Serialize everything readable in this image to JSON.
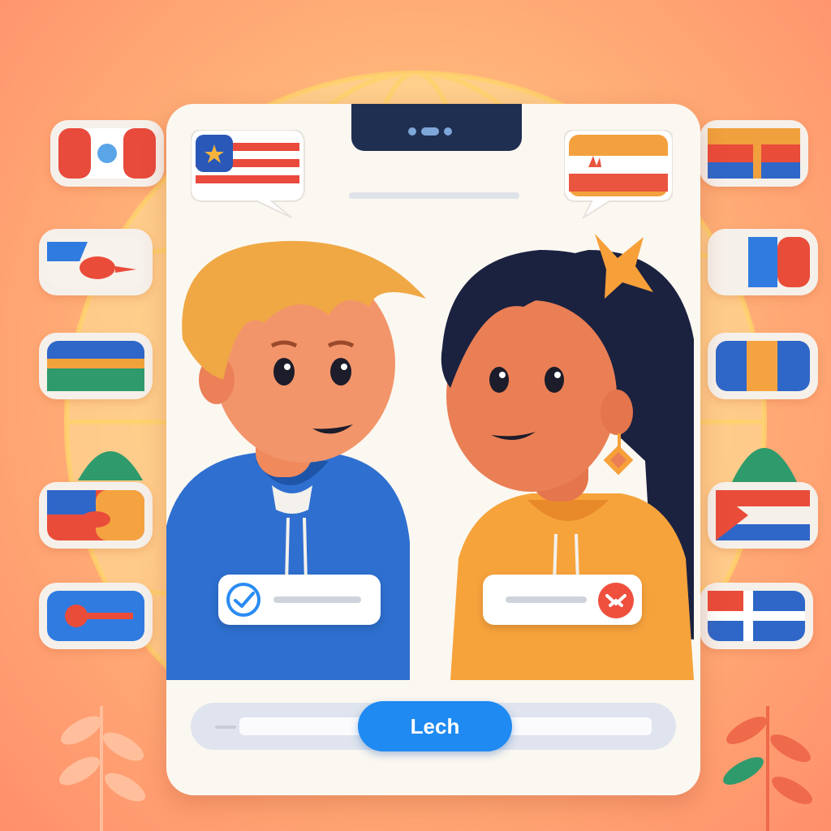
{
  "app": {
    "action_button_label": "Lech"
  },
  "colors": {
    "accent_blue": "#1f8af1",
    "boy_hoodie": "#2e6fcf",
    "girl_hoodie": "#f7a33c",
    "background_warm": "#ff9f70",
    "confirm_check": "#2a8bf2",
    "decline_red": "#ef4f3d"
  },
  "icons": {
    "confirm": "checkmark-icon",
    "decline": "chevron-x-icon",
    "left_bubble_flag": "striped-flag-icon",
    "right_bubble_flag": "orange-white-flag-icon"
  }
}
